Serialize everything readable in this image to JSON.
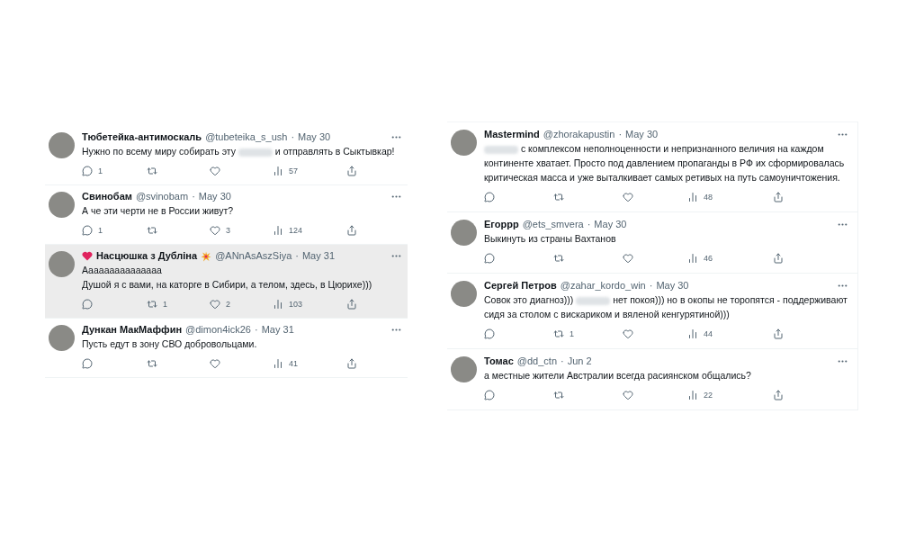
{
  "panels": [
    {
      "tweets": [
        {
          "name": "Тюбетейка-антимоскаль",
          "handle": "@tubeteika_s_ush",
          "separator": "·",
          "date": "May 30",
          "highlighted": false,
          "segments": [
            {
              "kind": "text",
              "text": "Нужно по всему миру собирать эту "
            },
            {
              "kind": "blur"
            },
            {
              "kind": "text",
              "text": " и отправлять в Сыктывкар!"
            }
          ],
          "stats": {
            "replies": "1",
            "views": "57"
          }
        },
        {
          "name": "Свинобам",
          "handle": "@svinobam",
          "separator": "·",
          "date": "May 30",
          "highlighted": false,
          "segments": [
            {
              "kind": "text",
              "text": "А че эти черти не в России живут?"
            }
          ],
          "stats": {
            "replies": "1",
            "likes": "3",
            "views": "124"
          }
        },
        {
          "name": "Насцюшка з Дубліна",
          "heart_before_name": true,
          "burst_after_name": true,
          "handle": "@ANnAsAszSiya",
          "separator": "·",
          "date": "May 31",
          "highlighted": true,
          "segments": [
            {
              "kind": "text",
              "text": "Ааааааааааааааа\nДушой я с вами, на каторге в Сибири, а телом, здесь, в Цюрихе)))"
            }
          ],
          "stats": {
            "retweets": "1",
            "likes": "2",
            "views": "103"
          }
        },
        {
          "name": "Дункан МакМаффин",
          "handle": "@dimon4ick26",
          "separator": "·",
          "date": "May 31",
          "highlighted": false,
          "segments": [
            {
              "kind": "text",
              "text": "Пусть едут в зону СВО добровольцами."
            }
          ],
          "stats": {
            "views": "41"
          }
        }
      ]
    },
    {
      "tweets": [
        {
          "name": "Mastermind",
          "handle": "@zhorakapustin",
          "separator": "·",
          "date": "May 30",
          "highlighted": false,
          "segments": [
            {
              "kind": "blur"
            },
            {
              "kind": "text",
              "text": " с комплексом неполноценности и непризнанного величия на каждом континенте хватает. Просто под давлением пропаганды в РФ их сформировалась критическая масса и уже выталкивает самых ретивых на путь самоуничтожения."
            }
          ],
          "stats": {
            "views": "48"
          }
        },
        {
          "name": "Егорpp",
          "handle": "@ets_smvera",
          "separator": "·",
          "date": "May 30",
          "highlighted": false,
          "segments": [
            {
              "kind": "text",
              "text": "Выкинуть из страны Вахтанов"
            }
          ],
          "stats": {
            "views": "46"
          }
        },
        {
          "name": "Сергей Петров",
          "handle": "@zahar_kordo_win",
          "separator": "·",
          "date": "May 30",
          "highlighted": false,
          "segments": [
            {
              "kind": "text",
              "text": "Совок это диагноз))) "
            },
            {
              "kind": "blur"
            },
            {
              "kind": "text",
              "text": " нет покоя))) но в окопы не торопятся - поддерживают сидя за столом с вискариком и вяленой кенгурятиной)))"
            }
          ],
          "stats": {
            "retweets": "1",
            "views": "44"
          }
        },
        {
          "name": "Томас",
          "handle": "@dd_ctn",
          "separator": "·",
          "date": "Jun 2",
          "highlighted": false,
          "segments": [
            {
              "kind": "text",
              "text": "а местные жители Австралии всегда расиянском общались?"
            }
          ],
          "stats": {
            "views": "22"
          }
        }
      ]
    }
  ]
}
